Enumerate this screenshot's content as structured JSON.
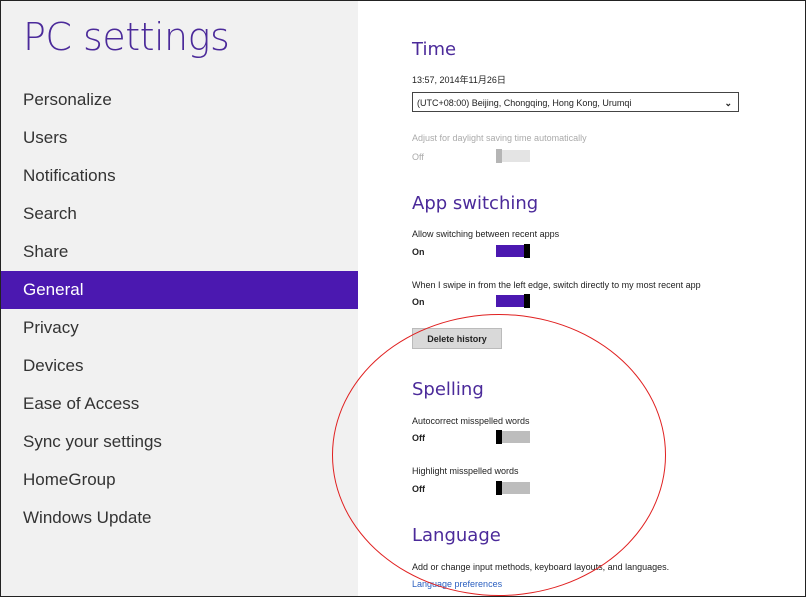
{
  "app_title": "PC settings",
  "nav": {
    "items": [
      {
        "label": "Personalize"
      },
      {
        "label": "Users"
      },
      {
        "label": "Notifications"
      },
      {
        "label": "Search"
      },
      {
        "label": "Share"
      },
      {
        "label": "General",
        "active": true
      },
      {
        "label": "Privacy"
      },
      {
        "label": "Devices"
      },
      {
        "label": "Ease of Access"
      },
      {
        "label": "Sync your settings"
      },
      {
        "label": "HomeGroup"
      },
      {
        "label": "Windows Update"
      }
    ]
  },
  "time": {
    "title": "Time",
    "datetime": "13:57, 2014年11月26日",
    "timezone": "(UTC+08:00) Beijing, Chongqing, Hong Kong, Urumqi",
    "dst_label": "Adjust for daylight saving time automatically",
    "dst_state": "Off",
    "dst_on": false
  },
  "app_switching": {
    "title": "App switching",
    "allow_label": "Allow switching between recent apps",
    "allow_state": "On",
    "allow_on": true,
    "swipe_label": "When I swipe in from the left edge, switch directly to my most recent app",
    "swipe_state": "On",
    "swipe_on": true,
    "delete_button": "Delete history"
  },
  "spelling": {
    "title": "Spelling",
    "autocorrect_label": "Autocorrect misspelled words",
    "autocorrect_state": "Off",
    "autocorrect_on": false,
    "highlight_label": "Highlight misspelled words",
    "highlight_state": "Off",
    "highlight_on": false
  },
  "language": {
    "title": "Language",
    "description": "Add or change input methods, keyboard layouts, and languages.",
    "link": "Language preferences"
  },
  "colors": {
    "accent": "#4b18b0",
    "title": "#4b2a9a",
    "annotation": "#e02020"
  }
}
